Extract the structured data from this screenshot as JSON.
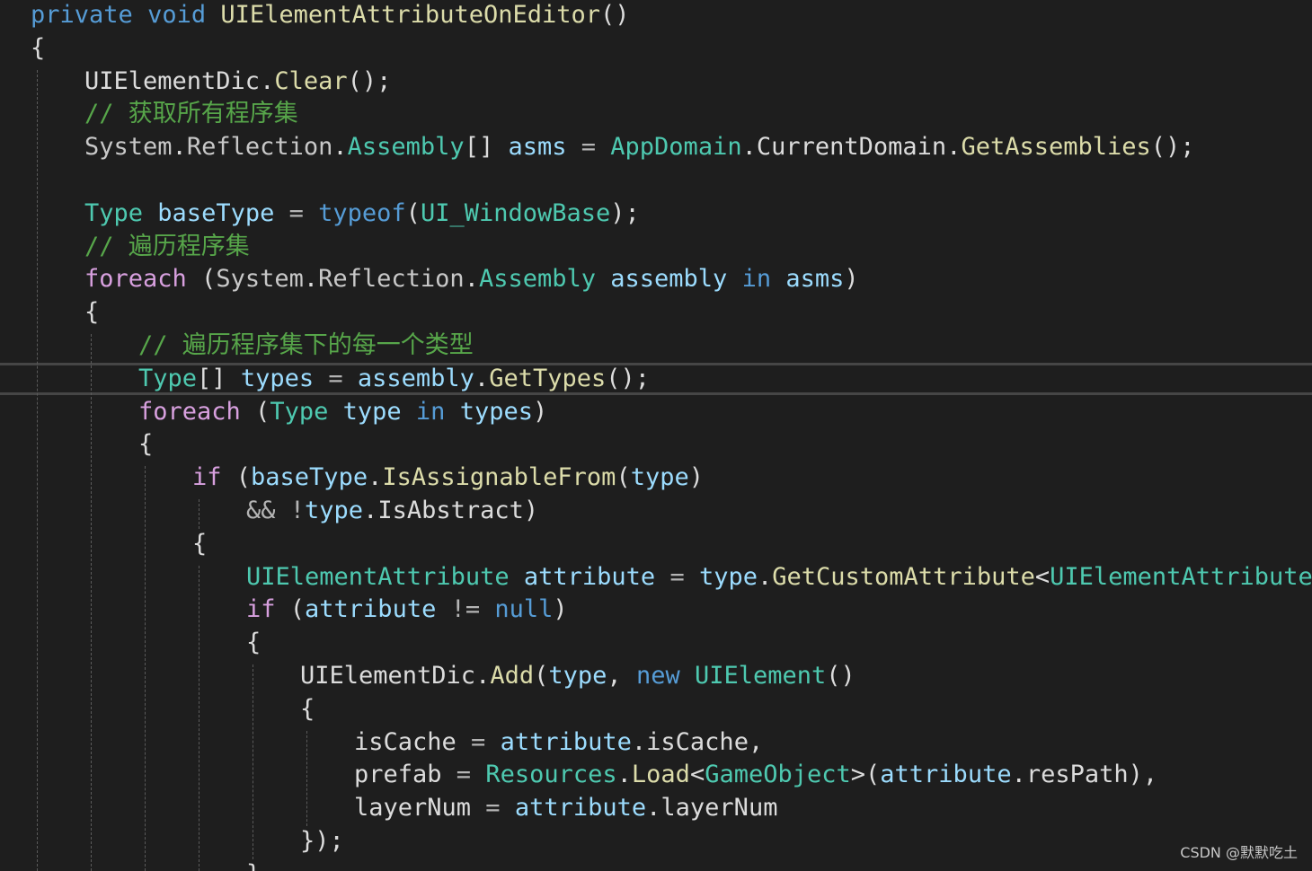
{
  "editor": {
    "colors": {
      "background": "#1e1e1e",
      "plain": "#dcdcdc",
      "keyword": "#569cd6",
      "type": "#4ec9b0",
      "method": "#dcdcaa",
      "comment": "#57a64a",
      "variable": "#9cdcfe",
      "namespace": "#c8c8c8",
      "operator": "#b4b4b4",
      "control": "#d8a0df",
      "current_line_border": "#464646",
      "indent_guide": "#5a5a5a"
    },
    "current_line_index": 11,
    "lines": [
      {
        "indent": 0,
        "tokens": [
          {
            "t": "private",
            "k": "keyword"
          },
          {
            "t": " "
          },
          {
            "t": "void",
            "k": "keyword"
          },
          {
            "t": " "
          },
          {
            "t": "UIElementAttributeOnEditor",
            "k": "method"
          },
          {
            "t": "()",
            "k": "plain"
          }
        ]
      },
      {
        "indent": 0,
        "tokens": [
          {
            "t": "{",
            "k": "plain"
          }
        ]
      },
      {
        "indent": 1,
        "tokens": [
          {
            "t": "UIElementDic",
            "k": "plain"
          },
          {
            "t": ".",
            "k": "plain"
          },
          {
            "t": "Clear",
            "k": "method"
          },
          {
            "t": "();",
            "k": "plain"
          }
        ]
      },
      {
        "indent": 1,
        "tokens": [
          {
            "t": "// 获取所有程序集",
            "k": "comment"
          }
        ]
      },
      {
        "indent": 1,
        "tokens": [
          {
            "t": "System",
            "k": "namespace"
          },
          {
            "t": ".",
            "k": "plain"
          },
          {
            "t": "Reflection",
            "k": "namespace"
          },
          {
            "t": ".",
            "k": "plain"
          },
          {
            "t": "Assembly",
            "k": "type"
          },
          {
            "t": "[] ",
            "k": "plain"
          },
          {
            "t": "asms",
            "k": "variable"
          },
          {
            "t": " = ",
            "k": "operator"
          },
          {
            "t": "AppDomain",
            "k": "type"
          },
          {
            "t": ".",
            "k": "plain"
          },
          {
            "t": "CurrentDomain",
            "k": "plain"
          },
          {
            "t": ".",
            "k": "plain"
          },
          {
            "t": "GetAssemblies",
            "k": "method"
          },
          {
            "t": "();",
            "k": "plain"
          }
        ]
      },
      {
        "indent": 1,
        "tokens": []
      },
      {
        "indent": 1,
        "tokens": [
          {
            "t": "Type",
            "k": "type"
          },
          {
            "t": " "
          },
          {
            "t": "baseType",
            "k": "variable"
          },
          {
            "t": " = ",
            "k": "operator"
          },
          {
            "t": "typeof",
            "k": "keyword"
          },
          {
            "t": "(",
            "k": "plain"
          },
          {
            "t": "UI_WindowBase",
            "k": "type"
          },
          {
            "t": ");",
            "k": "plain"
          }
        ]
      },
      {
        "indent": 1,
        "tokens": [
          {
            "t": "// 遍历程序集",
            "k": "comment"
          }
        ]
      },
      {
        "indent": 1,
        "tokens": [
          {
            "t": "foreach",
            "k": "control"
          },
          {
            "t": " (",
            "k": "plain"
          },
          {
            "t": "System",
            "k": "namespace"
          },
          {
            "t": ".",
            "k": "plain"
          },
          {
            "t": "Reflection",
            "k": "namespace"
          },
          {
            "t": ".",
            "k": "plain"
          },
          {
            "t": "Assembly",
            "k": "type"
          },
          {
            "t": " "
          },
          {
            "t": "assembly",
            "k": "variable"
          },
          {
            "t": " "
          },
          {
            "t": "in",
            "k": "keyword"
          },
          {
            "t": " "
          },
          {
            "t": "asms",
            "k": "variable"
          },
          {
            "t": ")",
            "k": "plain"
          }
        ]
      },
      {
        "indent": 1,
        "tokens": [
          {
            "t": "{",
            "k": "plain"
          }
        ]
      },
      {
        "indent": 2,
        "tokens": [
          {
            "t": "// 遍历程序集下的每一个类型",
            "k": "comment"
          }
        ]
      },
      {
        "indent": 2,
        "tokens": [
          {
            "t": "Type",
            "k": "type"
          },
          {
            "t": "[] ",
            "k": "plain"
          },
          {
            "t": "types",
            "k": "variable"
          },
          {
            "t": " = ",
            "k": "operator"
          },
          {
            "t": "assembly",
            "k": "variable"
          },
          {
            "t": ".",
            "k": "plain"
          },
          {
            "t": "GetTypes",
            "k": "method"
          },
          {
            "t": "();",
            "k": "plain"
          }
        ]
      },
      {
        "indent": 2,
        "tokens": [
          {
            "t": "foreach",
            "k": "control"
          },
          {
            "t": " (",
            "k": "plain"
          },
          {
            "t": "Type",
            "k": "type"
          },
          {
            "t": " "
          },
          {
            "t": "type",
            "k": "variable"
          },
          {
            "t": " "
          },
          {
            "t": "in",
            "k": "keyword"
          },
          {
            "t": " "
          },
          {
            "t": "types",
            "k": "variable"
          },
          {
            "t": ")",
            "k": "plain"
          }
        ]
      },
      {
        "indent": 2,
        "tokens": [
          {
            "t": "{",
            "k": "plain"
          }
        ]
      },
      {
        "indent": 3,
        "tokens": [
          {
            "t": "if",
            "k": "control"
          },
          {
            "t": " (",
            "k": "plain"
          },
          {
            "t": "baseType",
            "k": "variable"
          },
          {
            "t": ".",
            "k": "plain"
          },
          {
            "t": "IsAssignableFrom",
            "k": "method"
          },
          {
            "t": "(",
            "k": "plain"
          },
          {
            "t": "type",
            "k": "variable"
          },
          {
            "t": ")",
            "k": "plain"
          }
        ]
      },
      {
        "indent": 4,
        "tokens": [
          {
            "t": "&& !",
            "k": "operator"
          },
          {
            "t": "type",
            "k": "variable"
          },
          {
            "t": ".",
            "k": "plain"
          },
          {
            "t": "IsAbstract",
            "k": "plain"
          },
          {
            "t": ")",
            "k": "plain"
          }
        ]
      },
      {
        "indent": 3,
        "tokens": [
          {
            "t": "{",
            "k": "plain"
          }
        ]
      },
      {
        "indent": 4,
        "tokens": [
          {
            "t": "UIElementAttribute",
            "k": "type"
          },
          {
            "t": " "
          },
          {
            "t": "attribute",
            "k": "variable"
          },
          {
            "t": " = ",
            "k": "operator"
          },
          {
            "t": "type",
            "k": "variable"
          },
          {
            "t": ".",
            "k": "plain"
          },
          {
            "t": "GetCustomAttribute",
            "k": "method"
          },
          {
            "t": "<",
            "k": "plain"
          },
          {
            "t": "UIElementAttribute",
            "k": "type"
          },
          {
            "t": ">();",
            "k": "plain"
          }
        ]
      },
      {
        "indent": 4,
        "tokens": [
          {
            "t": "if",
            "k": "control"
          },
          {
            "t": " (",
            "k": "plain"
          },
          {
            "t": "attribute",
            "k": "variable"
          },
          {
            "t": " != ",
            "k": "operator"
          },
          {
            "t": "null",
            "k": "keyword"
          },
          {
            "t": ")",
            "k": "plain"
          }
        ]
      },
      {
        "indent": 4,
        "tokens": [
          {
            "t": "{",
            "k": "plain"
          }
        ]
      },
      {
        "indent": 5,
        "tokens": [
          {
            "t": "UIElementDic",
            "k": "plain"
          },
          {
            "t": ".",
            "k": "plain"
          },
          {
            "t": "Add",
            "k": "method"
          },
          {
            "t": "(",
            "k": "plain"
          },
          {
            "t": "type",
            "k": "variable"
          },
          {
            "t": ", ",
            "k": "plain"
          },
          {
            "t": "new",
            "k": "keyword"
          },
          {
            "t": " "
          },
          {
            "t": "UIElement",
            "k": "type"
          },
          {
            "t": "()",
            "k": "plain"
          }
        ]
      },
      {
        "indent": 5,
        "tokens": [
          {
            "t": "{",
            "k": "plain"
          }
        ]
      },
      {
        "indent": 6,
        "tokens": [
          {
            "t": "isCache",
            "k": "plain"
          },
          {
            "t": " = ",
            "k": "operator"
          },
          {
            "t": "attribute",
            "k": "variable"
          },
          {
            "t": ".",
            "k": "plain"
          },
          {
            "t": "isCache",
            "k": "plain"
          },
          {
            "t": ",",
            "k": "plain"
          }
        ]
      },
      {
        "indent": 6,
        "tokens": [
          {
            "t": "prefab",
            "k": "plain"
          },
          {
            "t": " = ",
            "k": "operator"
          },
          {
            "t": "Resources",
            "k": "type"
          },
          {
            "t": ".",
            "k": "plain"
          },
          {
            "t": "Load",
            "k": "method"
          },
          {
            "t": "<",
            "k": "plain"
          },
          {
            "t": "GameObject",
            "k": "type"
          },
          {
            "t": ">(",
            "k": "plain"
          },
          {
            "t": "attribute",
            "k": "variable"
          },
          {
            "t": ".",
            "k": "plain"
          },
          {
            "t": "resPath",
            "k": "plain"
          },
          {
            "t": "),",
            "k": "plain"
          }
        ]
      },
      {
        "indent": 6,
        "tokens": [
          {
            "t": "layerNum",
            "k": "plain"
          },
          {
            "t": " = ",
            "k": "operator"
          },
          {
            "t": "attribute",
            "k": "variable"
          },
          {
            "t": ".",
            "k": "plain"
          },
          {
            "t": "layerNum",
            "k": "plain"
          }
        ]
      },
      {
        "indent": 5,
        "tokens": [
          {
            "t": "});",
            "k": "plain"
          }
        ]
      },
      {
        "indent": 4,
        "tokens": [
          {
            "t": "}",
            "k": "plain"
          }
        ]
      }
    ]
  },
  "watermark": "CSDN @默默吃土"
}
